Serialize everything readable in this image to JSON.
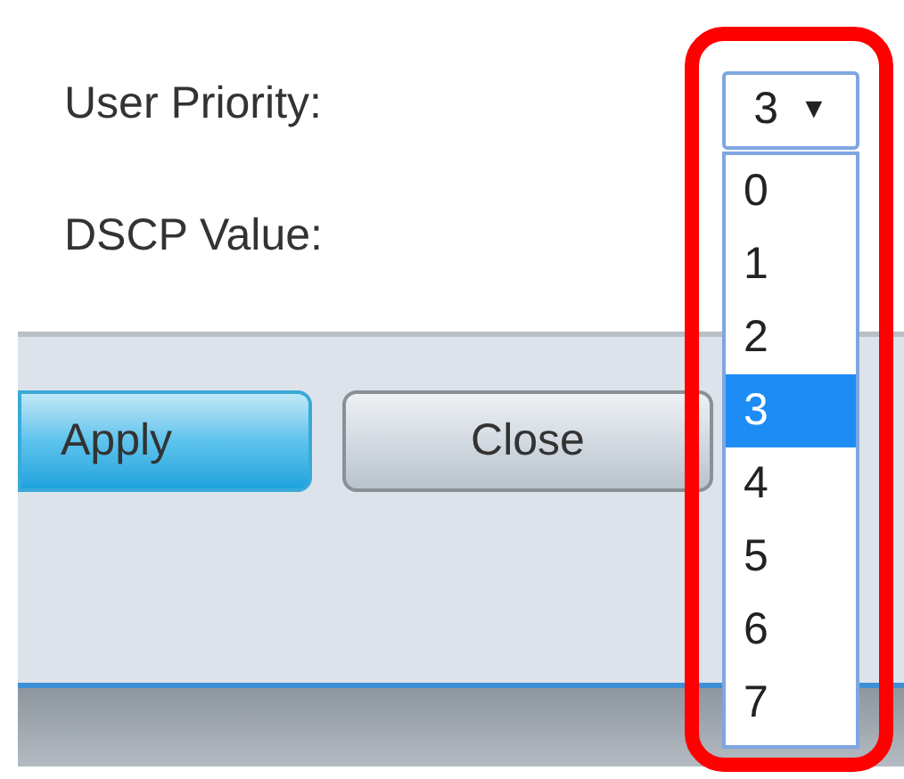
{
  "fields": [
    {
      "label": "User Priority:"
    },
    {
      "label": "DSCP Value:"
    }
  ],
  "priority_select": {
    "value": "3",
    "arrow": "▼",
    "options": [
      {
        "label": "0",
        "selected": false
      },
      {
        "label": "1",
        "selected": false
      },
      {
        "label": "2",
        "selected": false
      },
      {
        "label": "3",
        "selected": true
      },
      {
        "label": "4",
        "selected": false
      },
      {
        "label": "5",
        "selected": false
      },
      {
        "label": "6",
        "selected": false
      },
      {
        "label": "7",
        "selected": false
      }
    ]
  },
  "buttons": [
    {
      "label": "Apply",
      "kind": "primary"
    },
    {
      "label": "Close",
      "kind": "secondary"
    }
  ]
}
